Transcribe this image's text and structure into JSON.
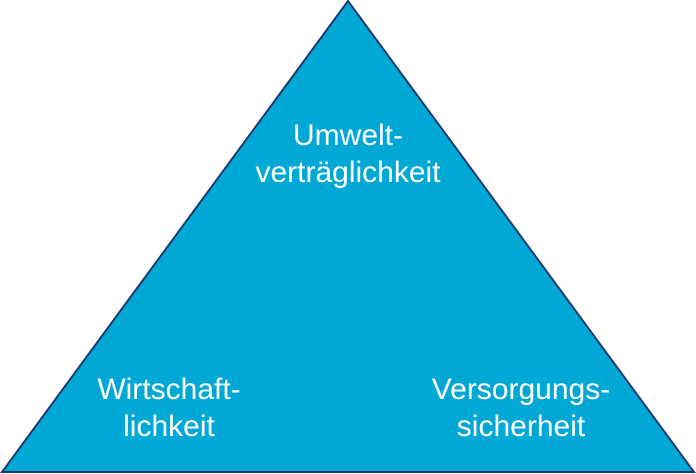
{
  "diagram": {
    "fill_color": "#00a8d6",
    "stroke_color": "#1a3a6e",
    "top_vertex": {
      "lines": [
        "Umwelt-",
        "verträglichkeit"
      ]
    },
    "bottom_left_vertex": {
      "lines": [
        "Wirtschaft-",
        "lichkeit"
      ]
    },
    "bottom_right_vertex": {
      "lines": [
        "Versorgungs-",
        "sicherheit"
      ]
    }
  }
}
